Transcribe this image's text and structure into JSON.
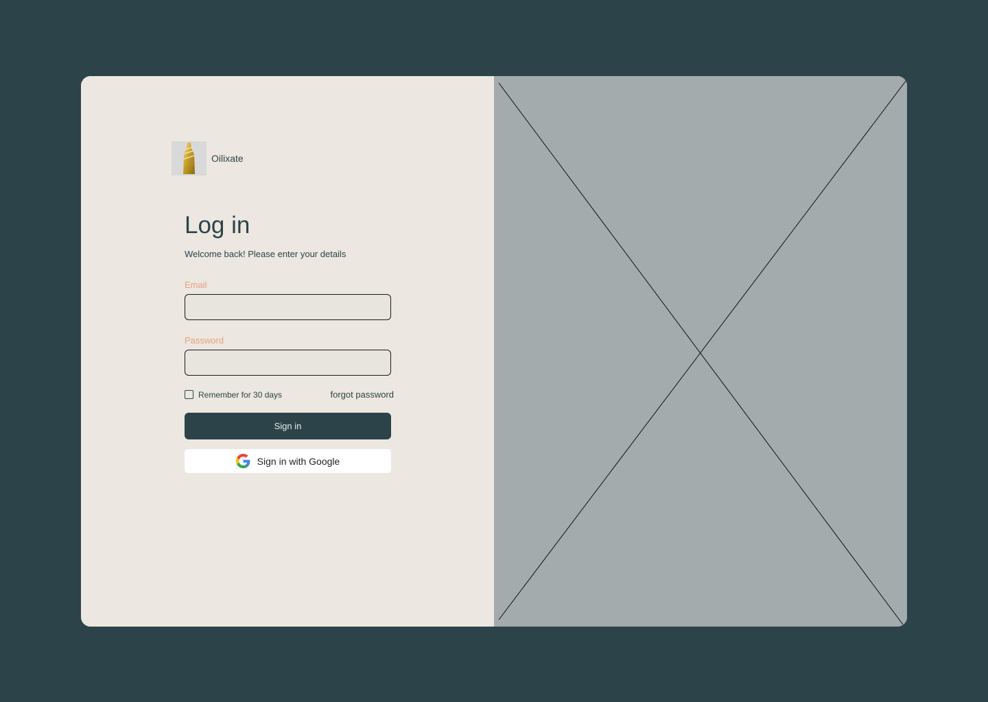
{
  "brand": {
    "name": "Oilixate",
    "logo_icon": "oil-bottle-icon"
  },
  "login": {
    "title": "Log in",
    "subtitle": "Welcome back! Please enter your details",
    "email_label": "Email",
    "email_value": "",
    "password_label": "Password",
    "password_value": "",
    "remember_label": "Remember for 30 days",
    "remember_checked": false,
    "forgot_label": "forgot password",
    "signin_label": "Sign in",
    "google_label": "Sign in with Google",
    "google_icon": "google-icon"
  },
  "image_placeholder": {
    "icon": "image-placeholder-cross"
  },
  "colors": {
    "background": "#2c4449",
    "panel": "#ece7e0",
    "placeholder": "#a4abad",
    "accent_label": "#e8a07d",
    "primary": "#2c4449"
  }
}
